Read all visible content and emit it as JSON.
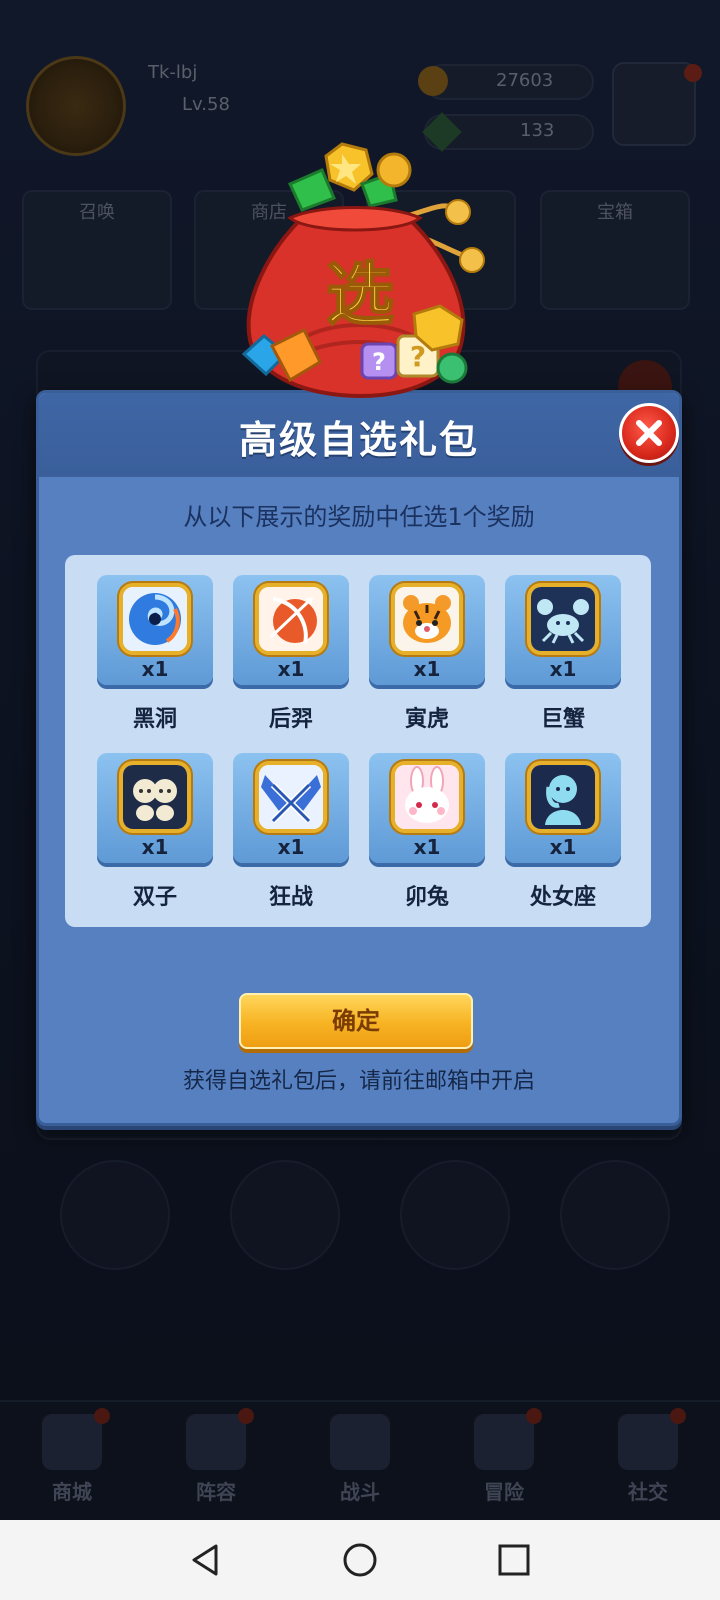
{
  "background": {
    "player_name": "Tk-lbj",
    "player_level": "Lv.58",
    "coins": "27603",
    "gems": "133",
    "tiles": [
      "召唤",
      "商店",
      "",
      "宝箱"
    ],
    "bottom_nav": [
      {
        "label": "商城",
        "icon": "shop-icon"
      },
      {
        "label": "阵容",
        "icon": "dice-icon"
      },
      {
        "label": "战斗",
        "icon": "swords-icon"
      },
      {
        "label": "冒险",
        "icon": "adventure-icon"
      },
      {
        "label": "社交",
        "icon": "chat-icon"
      }
    ]
  },
  "dialog": {
    "title": "高级自选礼包",
    "subtitle": "从以下展示的奖励中任选1个奖励",
    "close_icon": "close-icon",
    "bag_label": "选",
    "rewards": [
      {
        "name": "黑洞",
        "qty": "x1",
        "icon": "black-hole-icon"
      },
      {
        "name": "后羿",
        "qty": "x1",
        "icon": "houyi-archer-icon"
      },
      {
        "name": "寅虎",
        "qty": "x1",
        "icon": "tiger-icon"
      },
      {
        "name": "巨蟹",
        "qty": "x1",
        "icon": "crab-icon"
      },
      {
        "name": "双子",
        "qty": "x1",
        "icon": "gemini-icon"
      },
      {
        "name": "狂战",
        "qty": "x1",
        "icon": "berserker-icon"
      },
      {
        "name": "卯兔",
        "qty": "x1",
        "icon": "rabbit-icon"
      },
      {
        "name": "处女座",
        "qty": "x1",
        "icon": "virgo-icon"
      }
    ],
    "confirm_label": "确定",
    "footer_note": "获得自选礼包后，请前往邮箱中开启"
  },
  "system_nav": {
    "back_icon": "back-triangle-icon",
    "home_icon": "home-circle-icon",
    "recents_icon": "recents-square-icon"
  },
  "colors": {
    "dialog_bg": "#5680c0",
    "panel_bg": "#c8dcf4",
    "confirm_button": "#f7b323",
    "close_button": "#d8281c"
  }
}
